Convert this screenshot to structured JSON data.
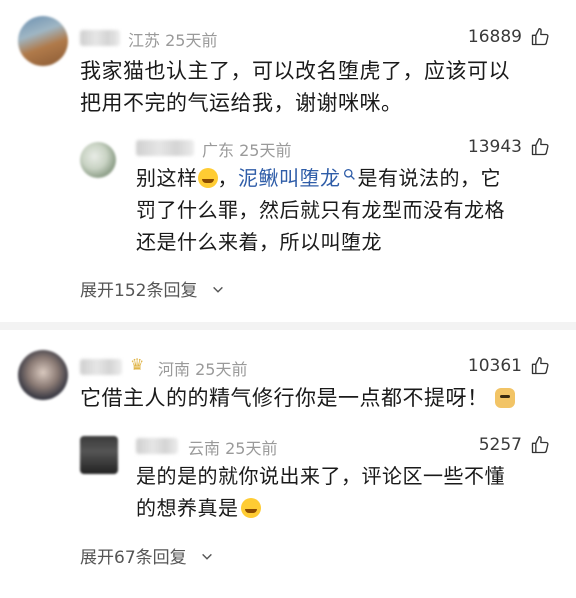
{
  "comments": [
    {
      "location_time": "江苏 25天前",
      "likes": "16889",
      "text_line1": "我家猫也认主了，可以改名堕虎了，应该可以",
      "text_line2": "把用不完的气运给我，谢谢咪咪。",
      "reply": {
        "location_time": "广东 25天前",
        "likes": "13943",
        "line1_pre": "别这样",
        "line1_link": "泥鳅叫堕龙",
        "line1_post": "是有说法的，它",
        "line2": "罚了什么罪，然后就只有龙型而没有龙格",
        "line3": "还是什么来着，所以叫堕龙"
      },
      "expand": "展开152条回复"
    },
    {
      "location_time": "河南 25天前",
      "likes": "10361",
      "text_line1": "它借主人的的精气修行你是一点都不提呀！",
      "reply": {
        "location_time": "云南 25天前",
        "likes": "5257",
        "line1": "是的是的就你说出来了，评论区一些不懂",
        "line2": "的想养真是"
      },
      "expand": "展开67条回复"
    }
  ],
  "icons": {
    "thumb": "thumbs-up-icon",
    "chevron": "chevron-down-icon",
    "search": "search-icon",
    "cry_emoji": "crying-face-emoji",
    "dog_emoji": "doge-emoji"
  },
  "colors": {
    "link": "#2f5da8",
    "meta": "#9a9a9a",
    "divider": "#f3f3f3"
  }
}
